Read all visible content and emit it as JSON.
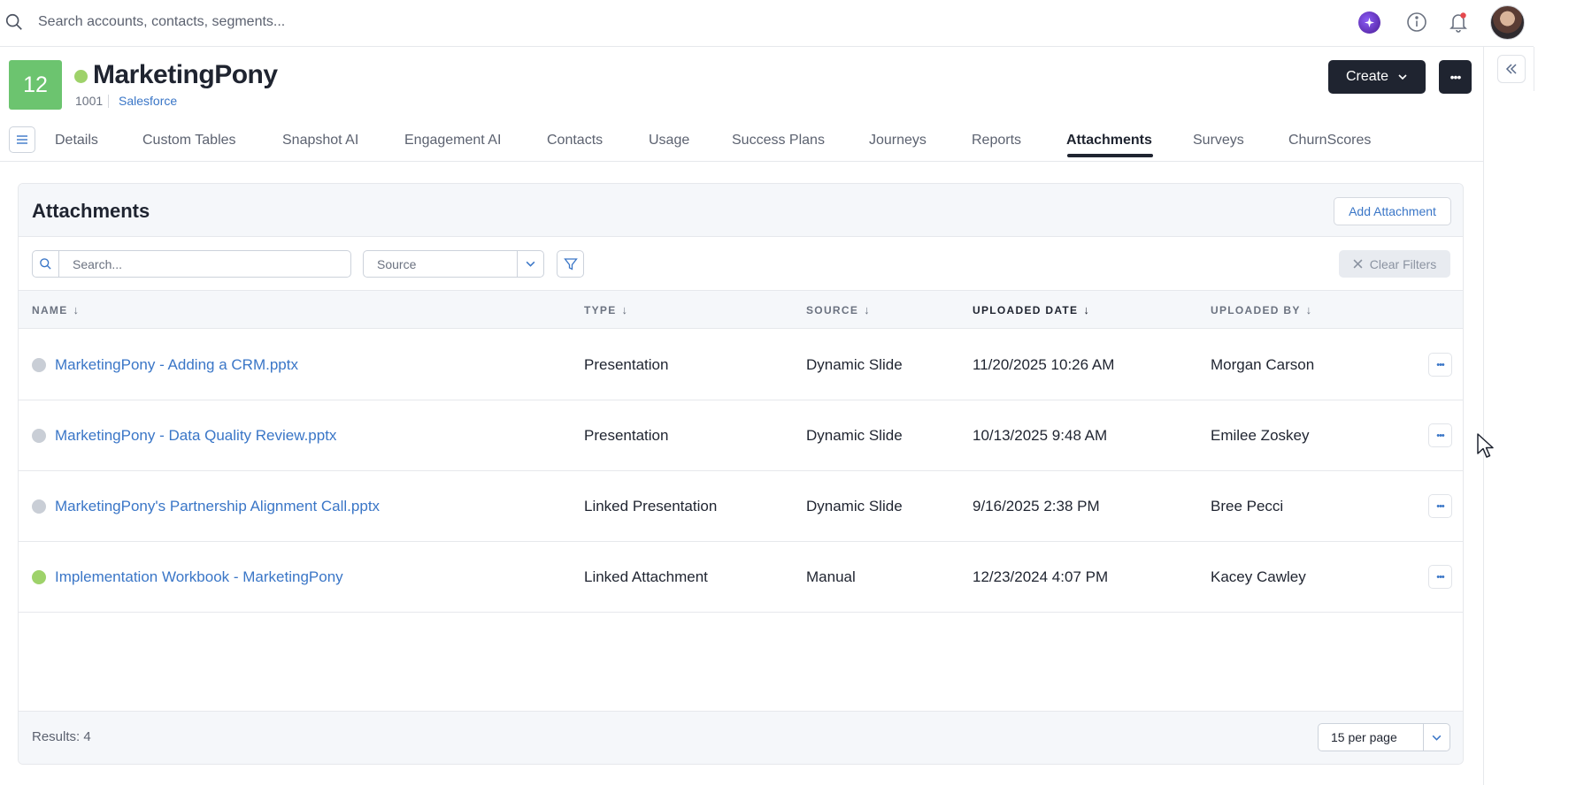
{
  "topbar": {
    "search_placeholder": "Search accounts, contacts, segments..."
  },
  "account": {
    "badge": "12",
    "name": "MarketingPony",
    "id": "1001",
    "source": "Salesforce",
    "status_color": "#9ed26a"
  },
  "actions": {
    "create_label": "Create",
    "more_label": "•••"
  },
  "tabs": [
    {
      "label": "Details"
    },
    {
      "label": "Custom Tables"
    },
    {
      "label": "Snapshot AI"
    },
    {
      "label": "Engagement AI"
    },
    {
      "label": "Contacts"
    },
    {
      "label": "Usage"
    },
    {
      "label": "Success Plans"
    },
    {
      "label": "Journeys"
    },
    {
      "label": "Reports"
    },
    {
      "label": "Attachments",
      "active": true
    },
    {
      "label": "Surveys"
    },
    {
      "label": "ChurnScores"
    }
  ],
  "panel": {
    "title": "Attachments",
    "add_label": "Add Attachment",
    "search_placeholder": "Search...",
    "source_placeholder": "Source",
    "clear_label": "Clear Filters",
    "results_label": "Results: 4",
    "per_page": "15 per page"
  },
  "table": {
    "columns": [
      "NAME",
      "TYPE",
      "SOURCE",
      "UPLOADED DATE",
      "UPLOADED BY"
    ],
    "rows": [
      {
        "name": "MarketingPony - Adding a CRM.pptx",
        "type": "Presentation",
        "source": "Dynamic Slide",
        "date": "11/20/2025 10:26 AM",
        "by": "Morgan Carson",
        "status": "gray"
      },
      {
        "name": "MarketingPony - Data Quality Review.pptx",
        "type": "Presentation",
        "source": "Dynamic Slide",
        "date": "10/13/2025 9:48 AM",
        "by": "Emilee Zoskey",
        "status": "gray"
      },
      {
        "name": "MarketingPony's Partnership Alignment Call.pptx",
        "type": "Linked Presentation",
        "source": "Dynamic Slide",
        "date": "9/16/2025 2:38 PM",
        "by": "Bree Pecci",
        "status": "gray"
      },
      {
        "name": "Implementation Workbook - MarketingPony",
        "type": "Linked Attachment",
        "source": "Manual",
        "date": "12/23/2024 4:07 PM",
        "by": "Kacey Cawley",
        "status": "green"
      }
    ]
  },
  "colors": {
    "accent": "#3a76c7",
    "dark": "#1f2430",
    "badge": "#6cc46f"
  }
}
